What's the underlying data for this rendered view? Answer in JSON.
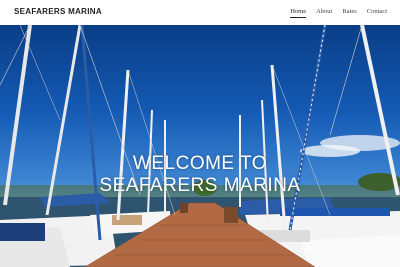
{
  "site": {
    "logo": "SEAFARERS MARINA"
  },
  "nav": {
    "items": [
      {
        "label": "Home",
        "active": true
      },
      {
        "label": "About",
        "active": false
      },
      {
        "label": "Rates",
        "active": false
      },
      {
        "label": "Contact",
        "active": false
      }
    ]
  },
  "hero": {
    "line1": "WELCOME TO",
    "line2": "SEAFARERS MARINA"
  },
  "colors": {
    "sky": "#1459b3",
    "dock": "#b26a45",
    "text": "#222222"
  }
}
